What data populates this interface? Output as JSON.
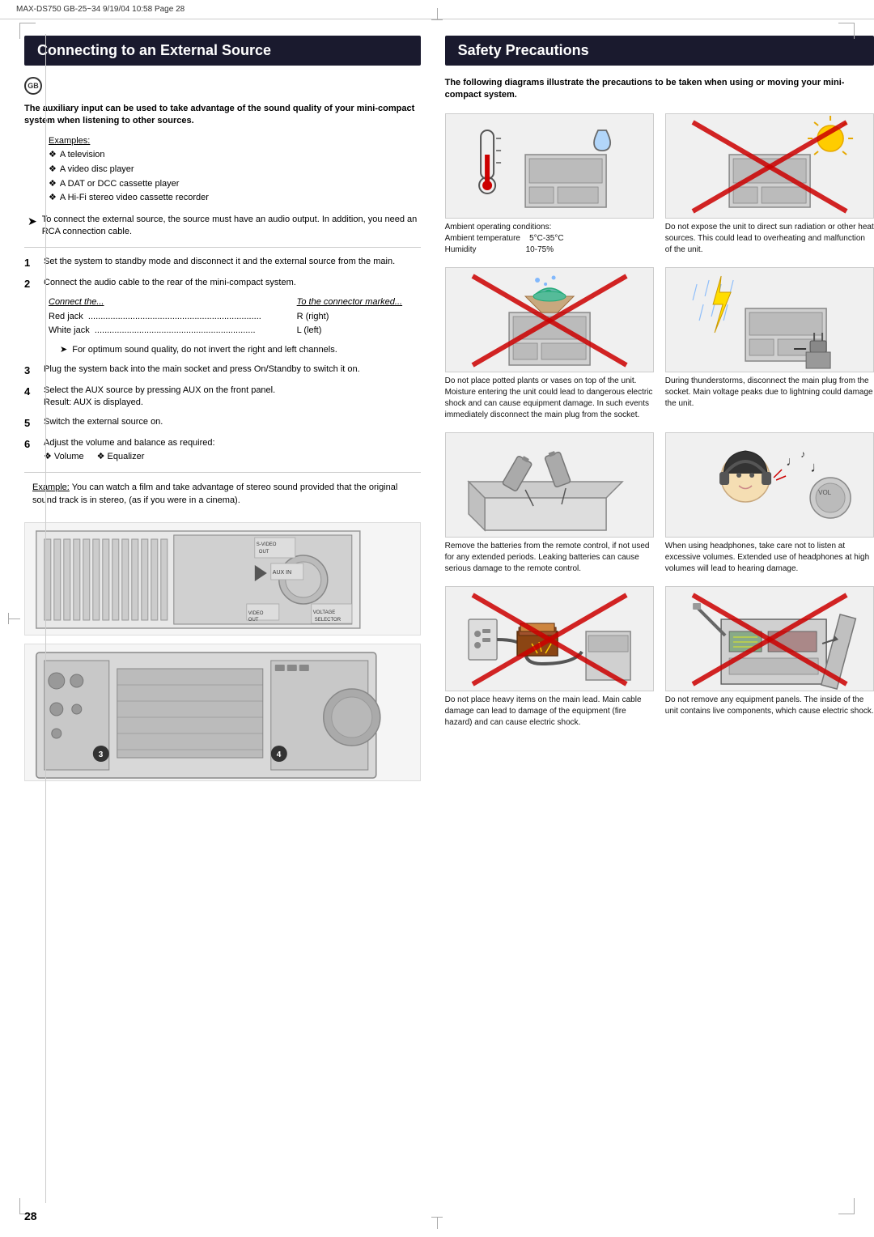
{
  "header": {
    "left_text": "MAX-DS750  GB-25~34  9/19/04  10:58  Page 28"
  },
  "left_section": {
    "title": "Connecting to an External Source",
    "gb_label": "GB",
    "intro": "The auxiliary input can be used to take advantage of the sound quality of your mini-compact system when listening to other sources.",
    "examples_label": "Examples:",
    "examples": [
      "A television",
      "A video disc player",
      "A DAT or DCC cassette player",
      "A Hi-Fi stereo video cassette recorder"
    ],
    "arrow_note": "To connect the external source, the source must have an audio output. In addition, you need an RCA connection cable.",
    "steps": [
      {
        "num": "1",
        "text": "Set the system to standby mode and disconnect it and the external source from the main."
      },
      {
        "num": "2",
        "text": "Connect the audio cable to the rear of the mini-compact system.",
        "table": {
          "col1_header": "Connect the...",
          "col2_header": "To the connector marked...",
          "rows": [
            [
              "Red jack",
              "R (right)"
            ],
            [
              "White jack",
              "L (left)"
            ]
          ]
        },
        "sub_note": "For optimum sound quality, do not invert the right and left channels."
      },
      {
        "num": "3",
        "text": "Plug the system back into the main socket and press On/Standby to switch it on."
      },
      {
        "num": "4",
        "text": "Select the AUX source by pressing AUX on the front panel.",
        "result": "Result: AUX is displayed."
      },
      {
        "num": "5",
        "text": "Switch the external source on."
      },
      {
        "num": "6",
        "text": "Adjust the volume and balance as required:",
        "bullets": [
          "Volume",
          "Equalizer"
        ]
      }
    ],
    "example_note": {
      "label": "Example:",
      "text": "You can watch a film and take advantage of stereo sound provided that the original sound track is in stereo, (as if you were in a cinema)."
    }
  },
  "right_section": {
    "title": "Safety Precautions",
    "intro": "The following diagrams illustrate the precautions to be taken when using or moving your mini-compact system.",
    "diagrams": [
      {
        "id": "ambient",
        "caption": "Ambient operating conditions:\nAmbient temperature    5°C-35°C\nHumidity                        10-75%",
        "has_cross": false,
        "type": "temperature"
      },
      {
        "id": "direct-sun",
        "caption": "Do not expose the unit to direct sun radiation or other heat sources. This could lead to overheating and malfunction of the unit.",
        "has_cross": true,
        "type": "sun"
      },
      {
        "id": "plants",
        "caption": "Do not place potted plants or vases on top of the unit. Moisture entering the unit could lead to dangerous electric shock and can cause equipment damage. In such events immediately disconnect the main plug from the socket.",
        "has_cross": true,
        "type": "plant"
      },
      {
        "id": "thunderstorm",
        "caption": "During thunderstorms, disconnect the main plug from the socket. Main voltage peaks due to lightning could damage the unit.",
        "has_cross": false,
        "type": "lightning"
      },
      {
        "id": "batteries",
        "caption": "Remove the batteries from the remote control, if not used for any extended periods. Leaking batteries can cause serious damage to the remote control.",
        "has_cross": false,
        "type": "battery"
      },
      {
        "id": "headphones",
        "caption": "When using headphones, take care not to listen at excessive volumes. Extended use of headphones at high volumes will lead to hearing damage.",
        "has_cross": false,
        "type": "headphones"
      },
      {
        "id": "heavy-items",
        "caption": "Do not place heavy items on the main lead. Main cable damage can lead to damage of the equipment (fire hazard) and can cause electric shock.",
        "has_cross": true,
        "type": "cable"
      },
      {
        "id": "panels",
        "caption": "Do not remove any equipment panels. The inside of the unit contains live components, which cause electric shock.",
        "has_cross": true,
        "type": "panel"
      }
    ]
  },
  "page_number": "28"
}
